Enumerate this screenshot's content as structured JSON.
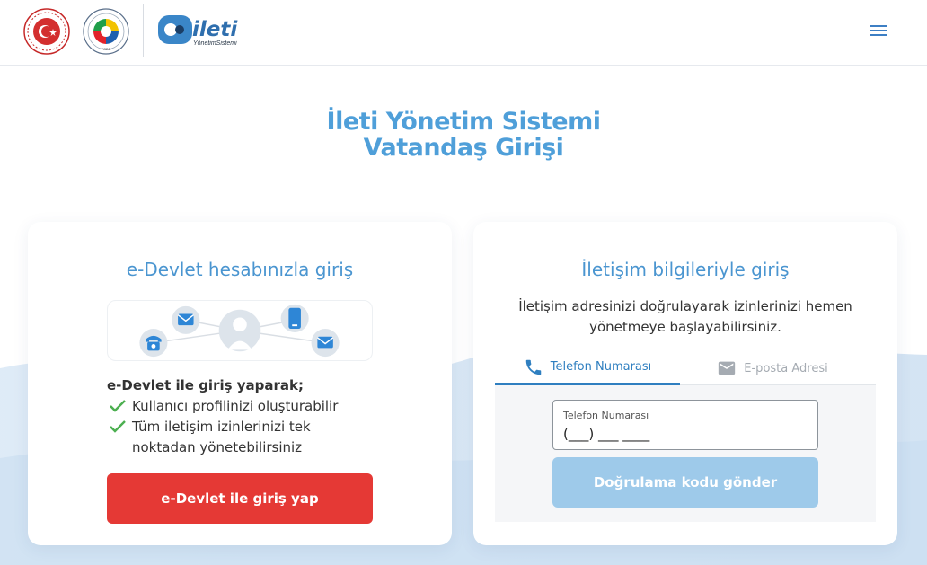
{
  "header": {
    "logo_text": "ileti",
    "logo_subtext": "YönetimSistemi",
    "tobb_mark": "TOBB",
    "menu_icon": "hamburger-menu-icon"
  },
  "title": {
    "line1": "İleti Yönetim Sistemi",
    "line2": "Vatandaş Girişi"
  },
  "left_card": {
    "title": "e-Devlet hesabınızla giriş",
    "intro": "e-Devlet ile giriş yaparak;",
    "features": [
      "Kullanıcı profilinizi oluşturabilir",
      "Tüm iletişim izinlerinizi tek noktadan yönetebilirsiniz"
    ],
    "button": "e-Devlet ile giriş yap"
  },
  "right_card": {
    "title": "İletişim bilgileriyle giriş",
    "description": "İletişim adresinizi doğrulayarak izinlerinizi hemen yönetmeye başlayabilirsiniz.",
    "tabs": [
      {
        "label": "Telefon Numarası",
        "icon": "phone-icon",
        "active": true
      },
      {
        "label": "E-posta Adresi",
        "icon": "mail-icon",
        "active": false
      }
    ],
    "phone_field": {
      "label": "Telefon Numarası",
      "value": "(___) ___ ____"
    },
    "button": "Doğrulama kodu gönder"
  },
  "colors": {
    "primary_blue": "#4f9fd9",
    "tab_active": "#2f7fc0",
    "edevlet_red": "#e53935",
    "send_button_disabled": "#9ecaea"
  }
}
